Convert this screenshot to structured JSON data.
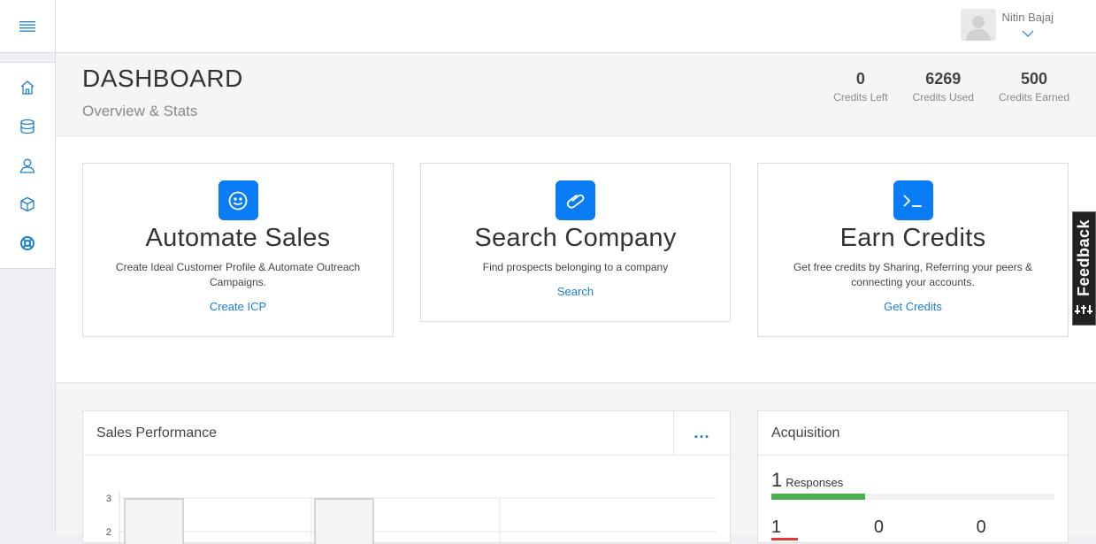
{
  "user": {
    "name": "Nitin Bajaj"
  },
  "sidebar": {
    "menu_icon": "hamburger-icon",
    "items": [
      {
        "icon": "home-icon"
      },
      {
        "icon": "database-icon"
      },
      {
        "icon": "user-icon"
      },
      {
        "icon": "cube-icon"
      },
      {
        "icon": "lifebuoy-icon"
      }
    ]
  },
  "header": {
    "title": "DASHBOARD",
    "subtitle": "Overview & Stats",
    "stats": [
      {
        "value": "0",
        "label": "Credits Left"
      },
      {
        "value": "6269",
        "label": "Credits Used"
      },
      {
        "value": "500",
        "label": "Credits Earned"
      }
    ]
  },
  "cards": [
    {
      "icon": "smiley-icon",
      "title": "Automate Sales",
      "desc": "Create Ideal Customer Profile & Automate Outreach Campaigns.",
      "link": "Create ICP"
    },
    {
      "icon": "paperclip-icon",
      "title": "Search Company",
      "desc": "Find prospects belonging to a company",
      "link": "Search"
    },
    {
      "icon": "terminal-icon",
      "title": "Earn Credits",
      "desc": "Get free credits by Sharing, Referring your peers & connecting your accounts.",
      "link": "Get Credits"
    }
  ],
  "sales_performance": {
    "title": "Sales Performance",
    "more": "...",
    "y_ticks": [
      "3",
      "2"
    ]
  },
  "acquisition": {
    "title": "Acquisition",
    "responses_value": "1",
    "responses_label": "Responses",
    "responses_fraction": 0.33,
    "row_values": [
      "1",
      "0",
      "0"
    ]
  },
  "feedback": {
    "label": "Feedback"
  },
  "colors": {
    "accent": "#0a7cf5",
    "link": "#1a7fd4",
    "green": "#4caf50",
    "red": "#e53935"
  }
}
